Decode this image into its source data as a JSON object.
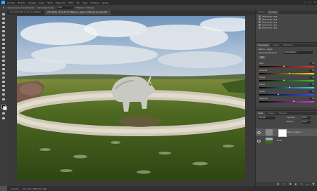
{
  "menubar": {
    "items": [
      "Archivo",
      "Edición",
      "Imagen",
      "Capa",
      "Texto",
      "Selección",
      "Filtro",
      "3D",
      "Vista",
      "Ventana",
      "Ayuda"
    ],
    "window_controls": [
      "—",
      "□",
      "✕"
    ]
  },
  "options": {
    "items": [
      "Opciones de herramienta",
      "Autoseleccionar:",
      "Capa"
    ],
    "field_value": "Mostrar controles"
  },
  "tabs": [
    {
      "label": "DSC_0012.NEF @ 16,7% (RGB/16)",
      "active": false
    },
    {
      "label": "DSC_0014 1.tif @ 16,7% (Blanco y negro 1, Máscara de capa/16) *",
      "active": true
    }
  ],
  "status": {
    "zoom": "16,67%",
    "doc": "Doc: 69,1 MB/143,2 MB"
  },
  "history_panel": {
    "tabs": [
      "Historia",
      "Acciones"
    ],
    "items": [
      "Seleccionar capa",
      "Seleccionar capa",
      "Seleccionar capa",
      "Seleccionar capa",
      "Seleccionar capa"
    ]
  },
  "properties_panel": {
    "tabs": [
      "Propiedades",
      "Ajustes",
      "Bibliotecas"
    ],
    "title": "Blanco y negro",
    "preset_label": "Ajuste preestablecido:",
    "preset_value": "Personalizado",
    "auto_label": "Auto",
    "sliders": [
      {
        "label": "Rojos",
        "value": 40,
        "percent": 0.45,
        "color_start": "#000000",
        "color_end": "#ff3030"
      },
      {
        "label": "Amarillos",
        "value": 60,
        "percent": 0.55,
        "color_start": "#000000",
        "color_end": "#ffe400"
      },
      {
        "label": "Verdes",
        "value": 40,
        "percent": 0.45,
        "color_start": "#000000",
        "color_end": "#30d030"
      },
      {
        "label": "Cianes",
        "value": 60,
        "percent": 0.55,
        "color_start": "#000000",
        "color_end": "#30e0f0"
      },
      {
        "label": "Azules",
        "value": 20,
        "percent": 0.35,
        "color_start": "#000000",
        "color_end": "#3050ff"
      },
      {
        "label": "Magentas",
        "value": 80,
        "percent": 0.62,
        "color_start": "#000000",
        "color_end": "#e030e0"
      }
    ]
  },
  "layers_panel": {
    "tabs": [
      "Capas",
      "Canales",
      "Trazados"
    ],
    "blend_mode": "Normal",
    "opacity_label": "Opacidad:",
    "opacity_value": "100%",
    "fill_label": "Relleno:",
    "fill_value": "100%",
    "layers": [
      {
        "name": "Blanco y negro 1",
        "selected": true
      },
      {
        "name": "Fondo",
        "selected": false
      }
    ]
  },
  "colors": {
    "accent": "#31a8ff"
  }
}
